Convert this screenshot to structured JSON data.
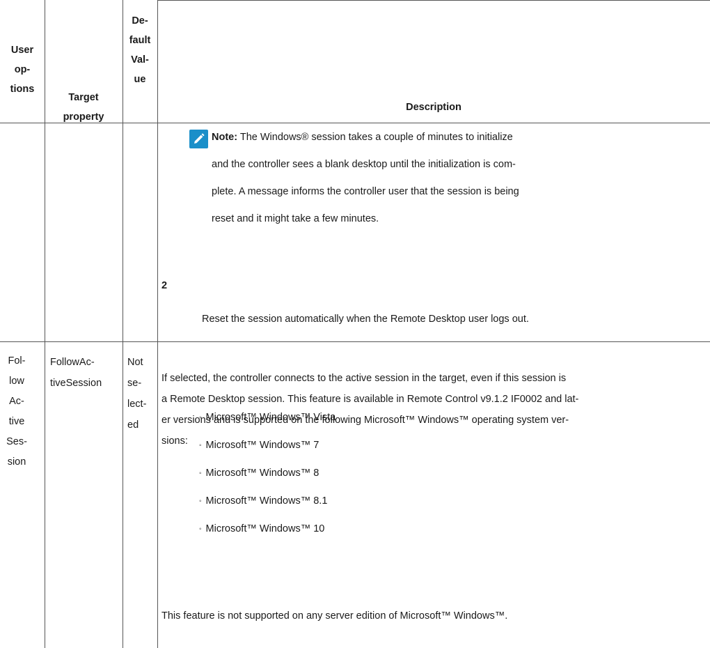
{
  "table": {
    "headers": {
      "user_options": [
        "User",
        "op-",
        "tions"
      ],
      "target_property": [
        "Target",
        "property"
      ],
      "default_value": [
        "De-",
        "fault",
        "Val-",
        "ue"
      ],
      "description": "Description"
    },
    "row1": {
      "note": {
        "label": "Note:",
        "lines": [
          "The Windows® session takes a couple of minutes to initialize",
          "and the controller sees a blank desktop until the initialization is com-",
          "plete. A message informs the controller user that the session is being",
          "reset and it might take a few minutes."
        ]
      },
      "step_number": "2",
      "step_text": "Reset the session automatically when the Remote Desktop user logs out."
    },
    "row2": {
      "user_option": [
        "Fol-",
        "low",
        "Ac-",
        "tive",
        "Ses-",
        "sion"
      ],
      "target_property": [
        "FollowAc-",
        "tiveSession"
      ],
      "default_value": [
        "Not",
        "se-",
        "lect-",
        "ed"
      ],
      "description_lines": [
        "If selected, the controller connects to the active session in the target, even if this session is",
        "a Remote Desktop session. This feature is available in Remote Control v9.1.2 IF0002 and lat-",
        "er versions and is supported on the following Microsoft™ Windows™ operating system ver-",
        "sions:"
      ],
      "versions": [
        "Microsoft™ Windows™ Vista",
        "Microsoft™ Windows™ 7",
        "Microsoft™ Windows™ 8",
        "Microsoft™ Windows™ 8.1",
        "Microsoft™ Windows™ 10"
      ],
      "final_note": "This feature is not supported on any server edition of Microsoft™ Windows™."
    }
  }
}
